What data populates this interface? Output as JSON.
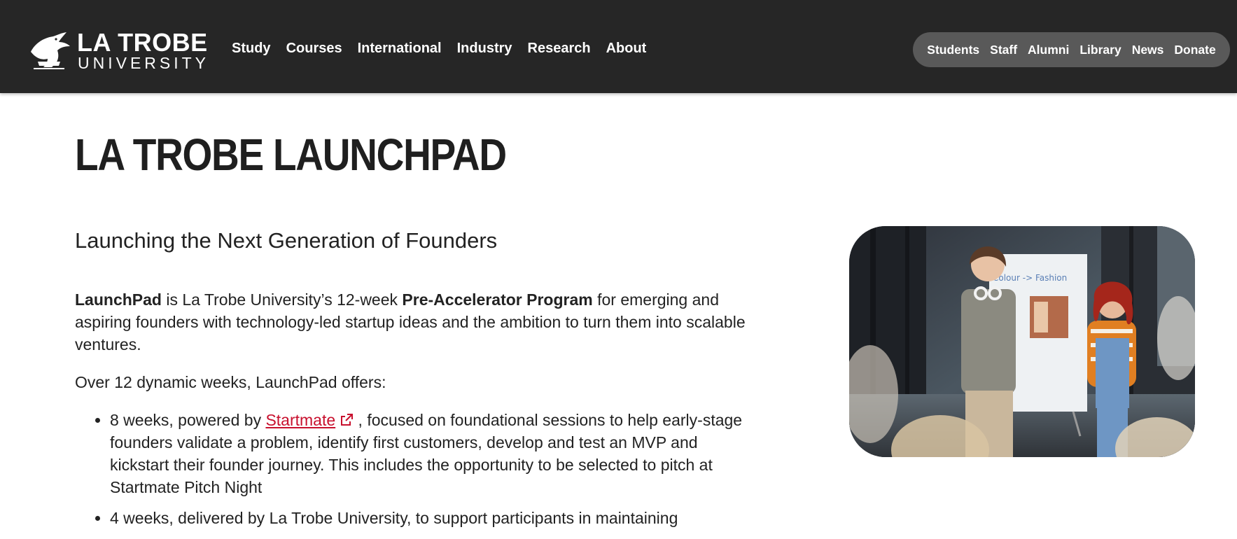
{
  "header": {
    "logo_line1": "LA TROBE",
    "logo_line2": "UNIVERSITY",
    "main_nav": [
      "Study",
      "Courses",
      "International",
      "Industry",
      "Research",
      "About"
    ],
    "utility_nav": [
      "Students",
      "Staff",
      "Alumni",
      "Library",
      "News",
      "Donate"
    ]
  },
  "page": {
    "title": "LA TROBE LAUNCHPAD",
    "subtitle": "Launching the Next Generation of Founders",
    "intro": {
      "bold1": "LaunchPad",
      "text1": " is La Trobe University’s 12-week ",
      "bold2": "Pre-Accelerator Program",
      "text2": " for emerging and aspiring founders with technology-led startup ideas and the ambition to turn them into scalable ventures."
    },
    "offers_intro": "Over 12 dynamic weeks, LaunchPad offers:",
    "bullets": [
      {
        "before": "8 weeks, powered by ",
        "link": "Startmate",
        "after": " , focused on foundational sessions to help early-stage founders validate a problem, identify first customers, develop and test an MVP and kickstart their founder journey. This includes the opportunity to be selected to pitch at Startmate Pitch Night"
      },
      {
        "text": "4 weeks, delivered by La Trobe University, to support participants in maintaining"
      }
    ]
  },
  "hero_image": {
    "whiteboard_text": "Colour -> Fashion"
  },
  "colors": {
    "header_bg": "#262626",
    "pill_bg": "#595959",
    "link_red": "#c8102e"
  }
}
